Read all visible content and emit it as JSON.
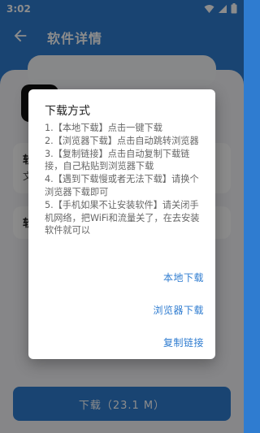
{
  "status_bar": {
    "time": "3:02",
    "icons": [
      "wifi-icon",
      "signal-icon",
      "battery-icon"
    ]
  },
  "app_bar": {
    "title": "软件详情",
    "back_icon": "arrow-back-icon"
  },
  "background": {
    "app_name": "",
    "cards": [
      {
        "label": "软",
        "sub": "文"
      },
      {
        "label": "软",
        "sub": ""
      }
    ],
    "download_button": "下载（23.1 M）"
  },
  "dialog": {
    "title": "下载方式",
    "lines": [
      "1.【本地下载】点击一键下载",
      "2.【浏览器下载】点击自动跳转浏览器",
      "3.【复制链接】点击自动复制下载链接，自己粘贴到浏览器下载",
      "4.【遇到下载慢或者无法下载】请换个浏览器下载即可",
      "5.【手机如果不让安装软件】请关闭手机网络，把WiFi和流量关了，在去安装软件就可以"
    ],
    "actions": {
      "local_download": "本地下载",
      "browser_download": "浏览器下载",
      "copy_link": "复制链接"
    }
  },
  "colors": {
    "primary": "#2f7cd0",
    "scrim": "rgba(0,0,0,0.45)"
  }
}
